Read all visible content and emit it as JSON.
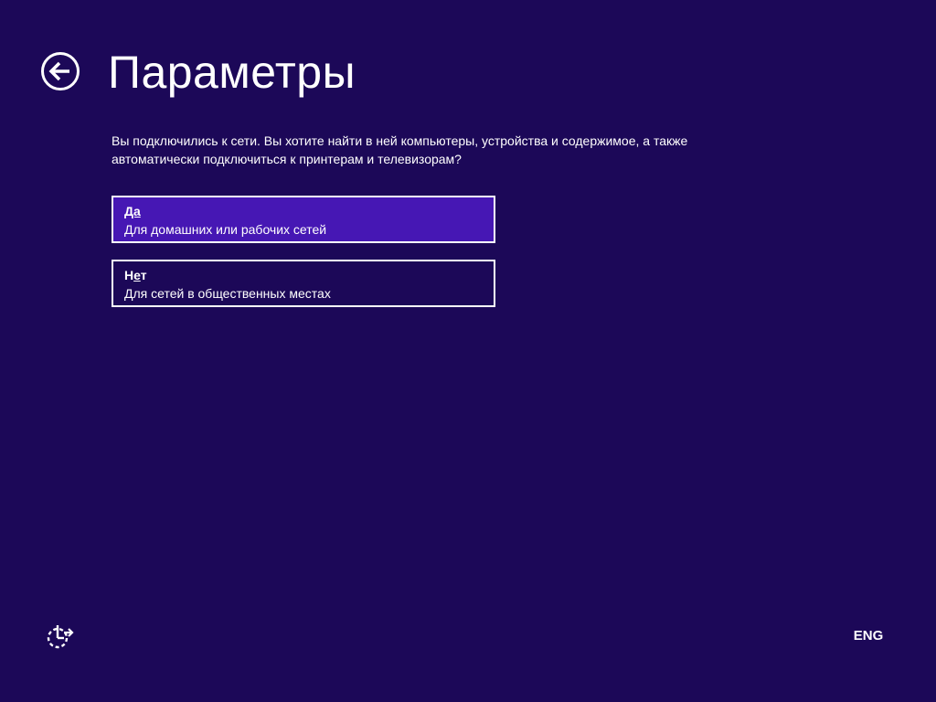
{
  "colors": {
    "background": "#1c0858",
    "selected_option": "#4617b4",
    "foreground": "#ffffff"
  },
  "icons": {
    "back": "back-arrow-icon",
    "ease_of_access": "ease-of-access-icon"
  },
  "header": {
    "title": "Параметры"
  },
  "main": {
    "prompt": "Вы подключились к сети. Вы хотите найти в ней компьютеры, устройства и содержимое, а также автоматически подключиться к принтерам и телевизорам?",
    "options": [
      {
        "title_underlined": "Да",
        "title_rest": "",
        "description": "Для домашних или рабочих сетей",
        "selected": true
      },
      {
        "title_before": "Н",
        "title_underlined": "е",
        "title_after": "т",
        "description": "Для сетей в общественных местах",
        "selected": false
      }
    ]
  },
  "footer": {
    "language": "ENG"
  }
}
